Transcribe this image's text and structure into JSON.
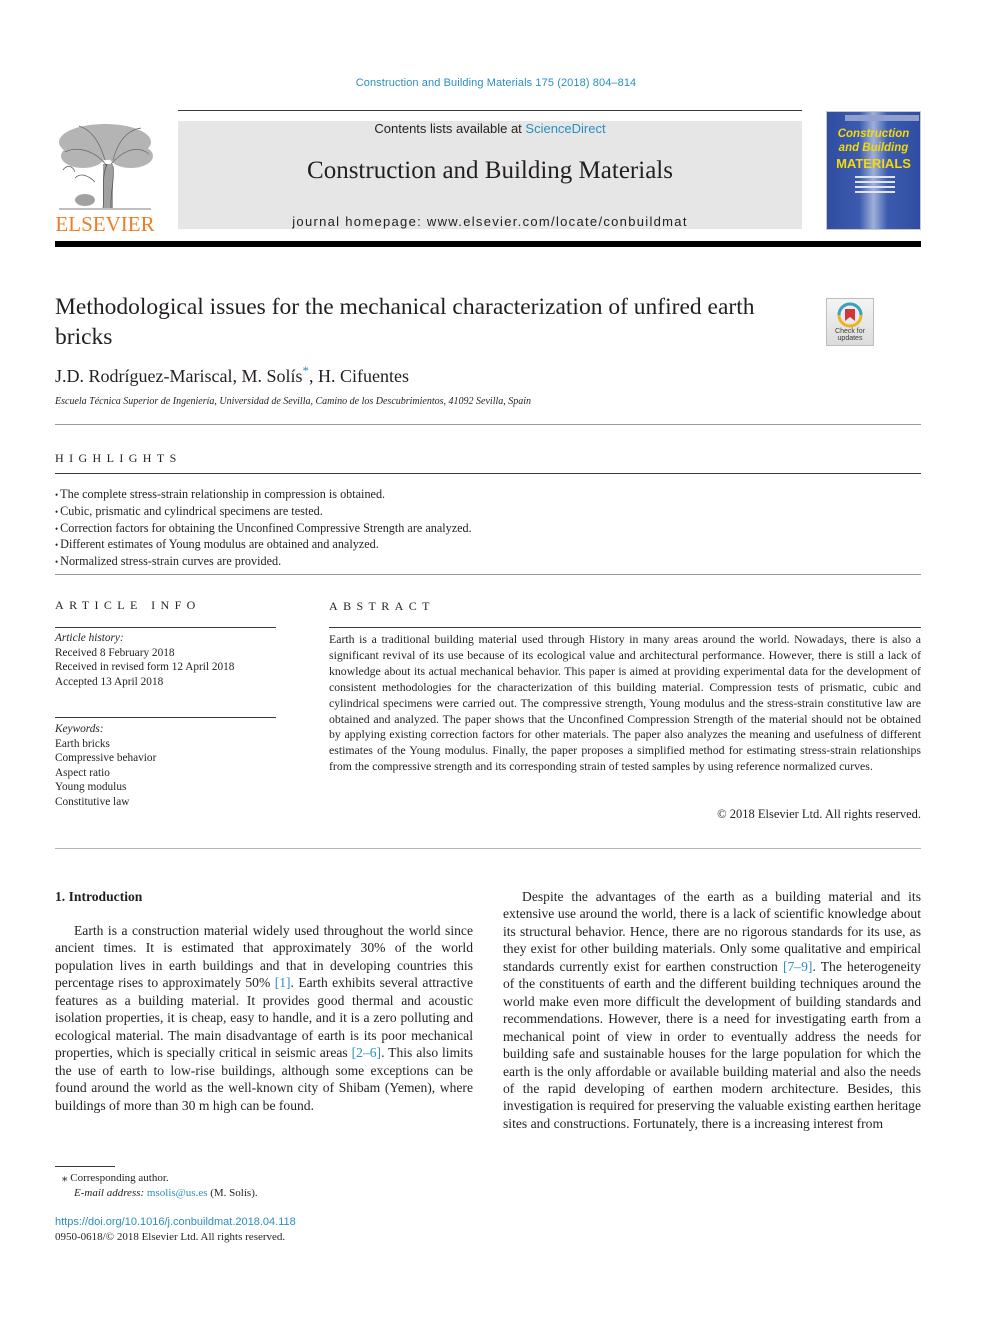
{
  "header": {
    "citation": "Construction and Building Materials 175 (2018) 804–814",
    "contents_prefix": "Contents lists available at ",
    "contents_link": "ScienceDirect",
    "journal_title": "Construction and Building Materials",
    "homepage": "journal homepage: www.elsevier.com/locate/conbuildmat",
    "publisher_logo_text": "ELSEVIER",
    "cover": {
      "line1": "Construction",
      "line2": "and Building",
      "line3": "MATERIALS"
    },
    "colors": {
      "link": "#2a8fbd",
      "elsevier_orange": "#ef7d22",
      "cover_blue": "#2f4da0",
      "cover_yellow": "#f5d90a"
    }
  },
  "article": {
    "title": "Methodological issues for the mechanical characterization of unfired earth bricks",
    "check_updates_label_1": "Check for",
    "check_updates_label_2": "updates",
    "authors": [
      {
        "name": "J.D. Rodríguez-Mariscal",
        "sep": ", "
      },
      {
        "name": "M. Solís",
        "mark": "*",
        "sep": ", "
      },
      {
        "name": "H. Cifuentes",
        "sep": ""
      }
    ],
    "affiliation": "Escuela Técnica Superior de Ingeniería, Universidad de Sevilla, Camino de los Descubrimientos, 41092 Sevilla, Spain"
  },
  "highlights": {
    "heading": "HIGHLIGHTS",
    "items": [
      "The complete stress-strain relationship in compression is obtained.",
      "Cubic, prismatic and cylindrical specimens are tested.",
      "Correction factors for obtaining the Unconfined Compressive Strength are analyzed.",
      "Different estimates of Young modulus are obtained and analyzed.",
      "Normalized stress-strain curves are provided."
    ]
  },
  "article_info": {
    "heading": "ARTICLE INFO",
    "history_label": "Article history:",
    "history": [
      "Received 8 February 2018",
      "Received in revised form 12 April 2018",
      "Accepted 13 April 2018"
    ],
    "keywords_label": "Keywords:",
    "keywords": [
      "Earth bricks",
      "Compressive behavior",
      "Aspect ratio",
      "Young modulus",
      "Constitutive law"
    ]
  },
  "abstract": {
    "heading": "ABSTRACT",
    "text": "Earth is a traditional building material used through History in many areas around the world. Nowadays, there is also a significant revival of its use because of its ecological value and architectural performance. However, there is still a lack of knowledge about its actual mechanical behavior. This paper is aimed at providing experimental data for the development of consistent methodologies for the characterization of this building material. Compression tests of prismatic, cubic and cylindrical specimens were carried out. The compressive strength, Young modulus and the stress-strain constitutive law are obtained and analyzed. The paper shows that the Unconfined Compression Strength of the material should not be obtained by applying existing correction factors for other materials. The paper also analyzes the meaning and usefulness of different estimates of the Young modulus. Finally, the paper proposes a simplified method for estimating stress-strain relationships from the compressive strength and its corresponding strain of tested samples by using reference normalized curves.",
    "copyright": "© 2018 Elsevier Ltd. All rights reserved."
  },
  "introduction": {
    "heading": "1. Introduction",
    "left_column": {
      "p1_a": "Earth is a construction material widely used throughout the world since ancient times. It is estimated that approximately 30% of the world population lives in earth buildings and that in developing countries this percentage rises to approximately 50% ",
      "ref1": "[1]",
      "p1_b": ". Earth exhibits several attractive features as a building material. It provides good thermal and acoustic isolation properties, it is cheap, easy to handle, and it is a zero polluting and ecological material. The main disadvantage of earth is its poor mechanical properties, which is specially critical in seismic areas ",
      "ref2": "[2–6]",
      "p1_c": ". This also limits the use of earth to low-rise buildings, although some exceptions can be found around the world as the well-known city of Shibam (Yemen), where buildings of more than 30 m high can be found."
    },
    "right_column": {
      "p2_a": "Despite the advantages of the earth as a building material and its extensive use around the world, there is a lack of scientific knowledge about its structural behavior. Hence, there are no rigorous standards for its use, as they exist for other building materials. Only some qualitative and empirical standards currently exist for earthen construction ",
      "ref3": "[7–9]",
      "p2_b": ". The heterogeneity of the constituents of earth and the different building techniques around the world make even more difficult the development of building standards and recommendations. However, there is a need for investigating earth from a mechanical point of view in order to eventually address the needs for building safe and sustainable houses for the large population for which the earth is the only affordable or available building material and also the needs of the rapid developing of earthen modern architecture. Besides, this investigation is required for preserving the valuable existing earthen heritage sites and constructions. Fortunately, there is a increasing interest from"
    }
  },
  "footnotes": {
    "corresponding_mark": "⁎",
    "corresponding": "Corresponding author.",
    "email_label": "E-mail address: ",
    "email": "msolis@us.es",
    "email_owner": " (M. Solís).",
    "doi": "https://doi.org/10.1016/j.conbuildmat.2018.04.118",
    "issn_copyright": "0950-0618/© 2018 Elsevier Ltd. All rights reserved."
  }
}
